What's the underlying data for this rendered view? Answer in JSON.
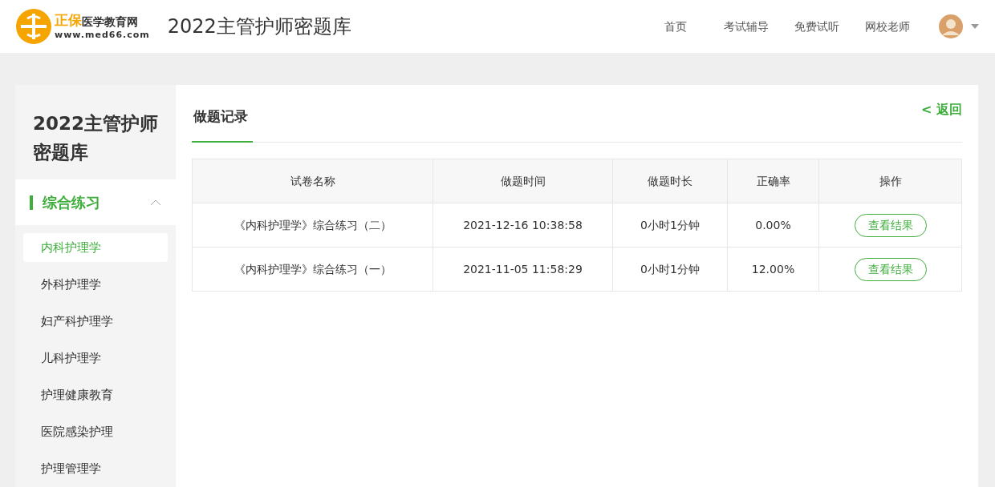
{
  "header": {
    "logo": {
      "brand_mark": "正保",
      "brand_name": "医学教育网",
      "url": "www.med66.com"
    },
    "site_title": "2022主管护师密题库",
    "nav": [
      {
        "label": "首页"
      },
      {
        "label": "考试辅导"
      },
      {
        "label": "免费试听"
      },
      {
        "label": "网校老师"
      }
    ]
  },
  "sidebar": {
    "title": "2022主管护师密题库",
    "section": {
      "label": "综合练习",
      "expanded": true
    },
    "items": [
      {
        "label": "内科护理学",
        "selected": true
      },
      {
        "label": "外科护理学",
        "selected": false
      },
      {
        "label": "妇产科护理学",
        "selected": false
      },
      {
        "label": "儿科护理学",
        "selected": false
      },
      {
        "label": "护理健康教育",
        "selected": false
      },
      {
        "label": "医院感染护理",
        "selected": false
      },
      {
        "label": "护理管理学",
        "selected": false
      }
    ]
  },
  "main": {
    "tab": "做题记录",
    "back_link": "< 返回",
    "table": {
      "columns": [
        "试卷名称",
        "做题时间",
        "做题时长",
        "正确率",
        "操作"
      ],
      "rows": [
        {
          "name": "《内科护理学》综合练习（二）",
          "time": "2021-12-16 10:38:58",
          "duration": "0小时1分钟",
          "accuracy": "0.00%",
          "action": "查看结果"
        },
        {
          "name": "《内科护理学》综合练习（一）",
          "time": "2021-11-05 11:58:29",
          "duration": "0小时1分钟",
          "accuracy": "12.00%",
          "action": "查看结果"
        }
      ]
    }
  }
}
